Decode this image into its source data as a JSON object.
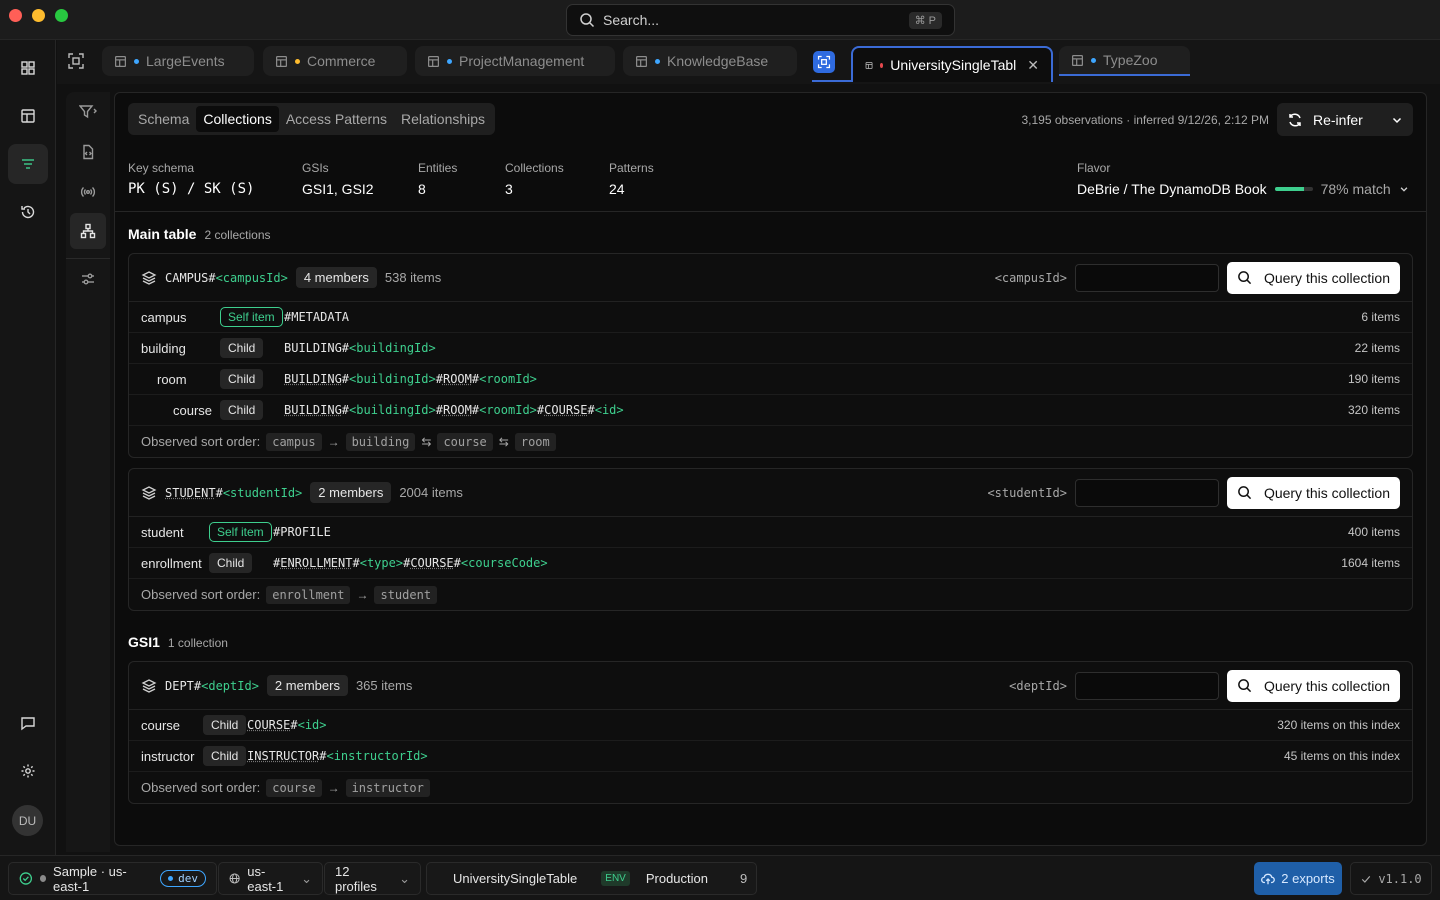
{
  "search": {
    "placeholder": "Search...",
    "shortcut": "⌘ P"
  },
  "tabs": [
    {
      "label": "LargeEvents"
    },
    {
      "label": "Commerce"
    },
    {
      "label": "ProjectManagement"
    },
    {
      "label": "KnowledgeBase"
    },
    {
      "label": "UniversitySingleTabl"
    },
    {
      "label": "TypeZoo"
    }
  ],
  "avatar": "DU",
  "subtabs": [
    "Schema",
    "Collections",
    "Access Patterns",
    "Relationships"
  ],
  "header": {
    "observations": "3,195 observations",
    "inferred": "inferred 9/12/26, 2:12 PM",
    "reinfer_label": "Re-infer"
  },
  "meta": {
    "key_schema_label": "Key schema",
    "key_schema_value": "PK (S) / SK (S)",
    "gsis_label": "GSIs",
    "gsis_value": "GSI1, GSI2",
    "entities_label": "Entities",
    "entities_value": "8",
    "collections_label": "Collections",
    "collections_value": "3",
    "patterns_label": "Patterns",
    "patterns_value": "24",
    "flavor_label": "Flavor",
    "flavor_value": "DeBrie / The DynamoDB Book",
    "match_label": "78% match",
    "match_fraction": 0.78
  },
  "main_table": {
    "title": "Main table",
    "count": "2 collections"
  },
  "gsi1": {
    "title": "GSI1",
    "count": "1 collection"
  },
  "query_label": "Query this collection",
  "sort_label": "Observed sort order:",
  "campus": {
    "pk_prefix": "CAMPUS#",
    "pk_param": "<campusId>",
    "members": "4 members",
    "items": "538 items",
    "param_label": "<campusId>",
    "rows": [
      {
        "name": "campus",
        "badge": "Self item",
        "sk_a": "#METADATA",
        "count": "6 items"
      },
      {
        "name": "building",
        "badge": "Child",
        "sk_a": "BUILDING#",
        "sk_b": "<buildingId>",
        "count": "22 items"
      },
      {
        "name": "room",
        "badge": "Child",
        "sk_a": "BUILDING",
        "sk_b": "#",
        "sk_c": "<buildingId>",
        "sk_d": "#",
        "sk_e": "ROOM",
        "sk_f": "#",
        "sk_g": "<roomId>",
        "count": "190 items"
      },
      {
        "name": "course",
        "badge": "Child",
        "sk_a": "BUILDING",
        "sk_b": "#",
        "sk_c": "<buildingId>",
        "sk_d": "#",
        "sk_e": "ROOM",
        "sk_f": "#",
        "sk_g": "<roomId>",
        "sk_h": "#",
        "sk_i": "COURSE",
        "sk_j": "#",
        "sk_k": "<id>",
        "count": "320 items"
      }
    ],
    "sort": [
      "campus",
      "building",
      "course",
      "room"
    ]
  },
  "student": {
    "pk_prefix": "STUDENT",
    "pk_hash": "#",
    "pk_param": "<studentId>",
    "members": "2 members",
    "items": "2004 items",
    "param_label": "<studentId>",
    "rows": [
      {
        "name": "student",
        "badge": "Self item",
        "sk_a": "#PROFILE",
        "count": "400 items"
      },
      {
        "name": "enrollment",
        "badge": "Child",
        "sk_a": "#",
        "sk_b": "ENROLLMENT",
        "sk_c": "#",
        "sk_d": "<type>",
        "sk_e": "#",
        "sk_f": "COURSE",
        "sk_g": "#",
        "sk_h": "<courseCode>",
        "count": "1604 items"
      }
    ],
    "sort": [
      "enrollment",
      "student"
    ]
  },
  "dept": {
    "pk_prefix": "DEPT#",
    "pk_param": "<deptId>",
    "members": "2 members",
    "items": "365 items",
    "param_label": "<deptId>",
    "rows": [
      {
        "name": "course",
        "badge": "Child",
        "sk_a": "COURSE",
        "sk_b": "#",
        "sk_c": "<id>",
        "count": "320 items on this index"
      },
      {
        "name": "instructor",
        "badge": "Child",
        "sk_a": "INSTRUCTOR",
        "sk_b": "#",
        "sk_c": "<instructorId>",
        "count": "45 items on this index"
      }
    ],
    "sort": [
      "course",
      "instructor"
    ]
  },
  "status": {
    "connection": "Sample · us-east-1",
    "dev": "dev",
    "region": "us-east-1",
    "profiles": "12 profiles",
    "table": "UniversitySingleTable",
    "env": "ENV",
    "env_name": "Production",
    "table_count": "9",
    "exports": "2 exports",
    "version": "v1.1.0"
  },
  "colors": {
    "accent_green": "#3ecf8e",
    "accent_blue": "#3b6bd6",
    "tab_dot_red": "#e5484d"
  }
}
